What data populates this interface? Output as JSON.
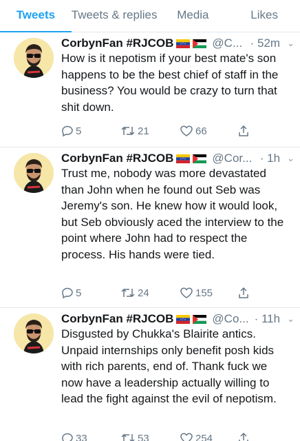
{
  "tabs": [
    {
      "label": "Tweets",
      "active": true
    },
    {
      "label": "Tweets & replies",
      "active": false
    },
    {
      "label": "Media",
      "active": false
    },
    {
      "label": "Likes",
      "active": false
    }
  ],
  "colors": {
    "accent": "#1da1f2",
    "muted": "#657786",
    "text": "#14171a",
    "divider": "#e1e8ed"
  },
  "tweets": [
    {
      "author": "CorbynFan #RJCOB",
      "flags": [
        "venezuela-flag",
        "palestine-flag"
      ],
      "handle": "@C...",
      "time": "· 52m",
      "text": "How is it nepotism if your best mate's son happens to be the best chief of staff in the business? You would be crazy to turn that shit down.",
      "replies": "5",
      "retweets": "21",
      "likes": "66"
    },
    {
      "author": "CorbynFan #RJCOB",
      "flags": [
        "venezuela-flag",
        "palestine-flag"
      ],
      "handle": "@Cor...",
      "time": "· 1h",
      "text": "Trust me, nobody was more devastated than John when he found out Seb was Jeremy's son. He knew how it would look, but Seb obviously aced the interview to the point where John had to respect the process. His hands were tied.",
      "replies": "5",
      "retweets": "24",
      "likes": "155"
    },
    {
      "author": "CorbynFan #RJCOB",
      "flags": [
        "venezuela-flag",
        "palestine-flag"
      ],
      "handle": "@Co...",
      "time": "· 11h",
      "text": "Disgusted by Chukka's Blairite antics. Unpaid internships only benefit posh kids with rich parents, end of. Thank fuck we now have a leadership actually willing to lead the fight against the evil of nepotism.",
      "replies": "33",
      "retweets": "53",
      "likes": "254"
    }
  ]
}
